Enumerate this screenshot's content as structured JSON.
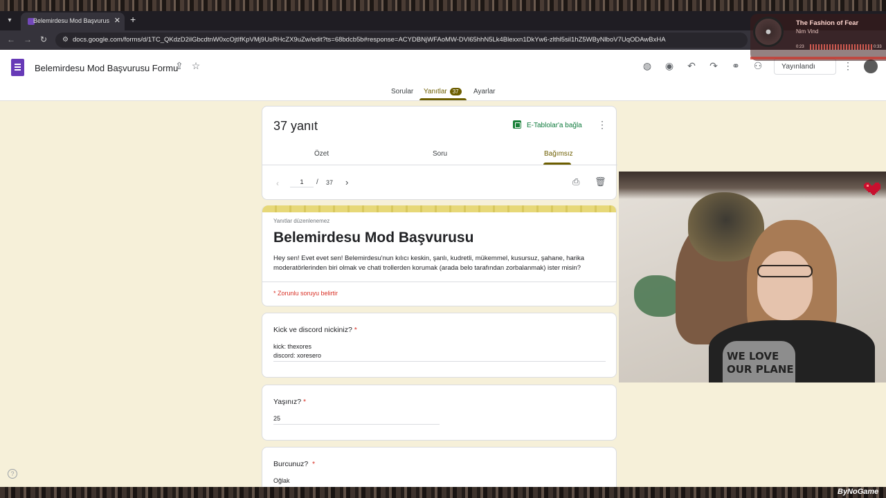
{
  "browser": {
    "tab_title": "Belemirdesu Mod Başvurusu Fo",
    "tab_close": "✕",
    "new_tab": "+",
    "url": "docs.google.com/forms/d/1TC_QKdzD2ilGbcdtnW0xcOjtIfKpVMj9UsRHcZX9uZw/edit?ts=68bdcb5b#response=ACYDBNjWFAoMW-DVl65hhN5Lk4Blexxn1DkYw6-zlthl5sil1hZ5WByNlboV7UqODAwBxHA"
  },
  "forms": {
    "title": "Belemirdesu Mod Başvurusu Formu",
    "publish_label": "Yayınlandı",
    "tabs": {
      "questions": "Sorular",
      "responses": "Yanıtlar",
      "responses_badge": "37",
      "settings": "Ayarlar"
    }
  },
  "summary": {
    "count_label": "37 yanıt",
    "sheets_link": "E-Tablolar'a bağla",
    "subtabs": {
      "summary": "Özet",
      "question": "Soru",
      "individual": "Bağımsız"
    },
    "pager": {
      "current": "1",
      "separator": "/",
      "total": "37"
    }
  },
  "form_header": {
    "no_edit_note": "Yanıtlar düzenlenemez",
    "heading": "Belemirdesu Mod Başvurusu",
    "description": "Hey sen! Evet evet sen! Belemirdesu'nun kılıcı keskin, şanlı, kudretli, mükemmel, kusursuz, şahane, harika moderatörlerinden biri olmak ve chati trollerden korumak (arada belo tarafından zorbalanmak) ister misin?",
    "required_note": "* Zorunlu soruyu belirtir"
  },
  "questions": [
    {
      "label": "Kick ve discord nickiniz?",
      "star": "*",
      "answer_line1": "kick: thexores",
      "answer_line2": "discord: xoresero"
    },
    {
      "label": "Yaşınız?",
      "star": "*",
      "answer": "25"
    },
    {
      "label": "Burcunuz?",
      "star": "*",
      "answer": "Oğlak"
    }
  ],
  "music": {
    "title": "The Fashion of Fear",
    "artist": "Nim Vind",
    "time_start": "0:23",
    "time_end": "0:33"
  },
  "webcam": {
    "shirt_text_line1": "WE LOVE",
    "shirt_text_line2": "OUR PLANE"
  },
  "watermark": "ByNoGame",
  "colors": {
    "accent": "#6d5e00",
    "background": "#f6f0d9",
    "forms_purple": "#673ab7",
    "required_red": "#d93025"
  }
}
